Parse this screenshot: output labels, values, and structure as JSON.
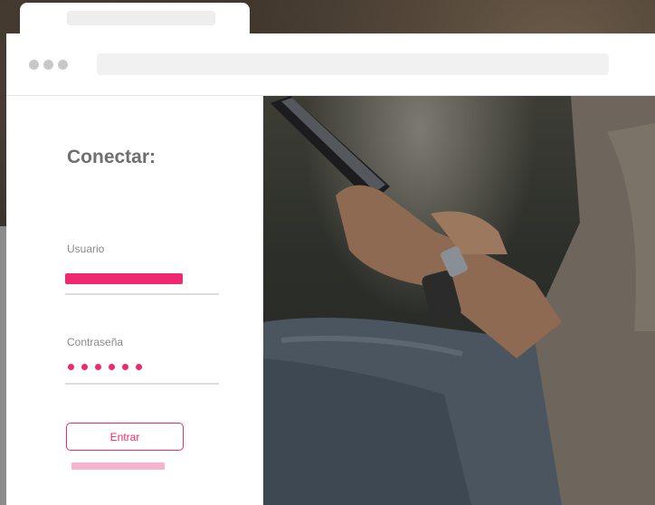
{
  "login": {
    "title": "Conectar:",
    "username_label": "Usuario",
    "password_label": "Contraseña",
    "password_dot_count": 6,
    "submit_label": "Entrar"
  },
  "colors": {
    "accent": "#f0286f",
    "accent_light": "#f6b3cb",
    "title_text": "#6f6f6f",
    "label_text": "#8a8a8a"
  },
  "icons": [
    "window-dots-icon"
  ]
}
